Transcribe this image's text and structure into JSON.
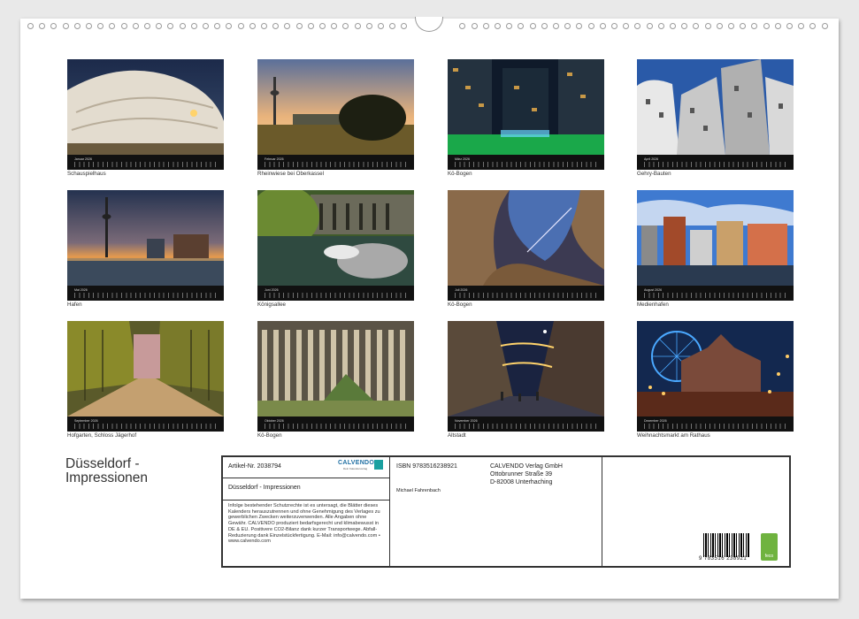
{
  "calendar": {
    "title_line1": "Düsseldorf -",
    "title_line2": "Impressionen",
    "months": [
      {
        "month": "Januar 2026",
        "caption": "Schauspielhaus"
      },
      {
        "month": "Februar 2026",
        "caption": "Rheinwiese bei Oberkassel"
      },
      {
        "month": "März 2026",
        "caption": "Kö-Bogen"
      },
      {
        "month": "April 2026",
        "caption": "Gehry-Bauten"
      },
      {
        "month": "Mai 2026",
        "caption": "Hafen"
      },
      {
        "month": "Juni 2026",
        "caption": "Königsallee"
      },
      {
        "month": "Juli 2026",
        "caption": "Kö-Bogen"
      },
      {
        "month": "August 2026",
        "caption": "Medienhafen"
      },
      {
        "month": "September 2026",
        "caption": "Hofgarten, Schloss Jägerhof"
      },
      {
        "month": "Oktober 2026",
        "caption": "Kö-Bogen"
      },
      {
        "month": "November 2026",
        "caption": "Altstadt"
      },
      {
        "month": "Dezember 2026",
        "caption": "Weihnachtsmarkt am Rathaus"
      }
    ]
  },
  "info": {
    "article": "Artikel-Nr. 2038794",
    "logo": "CALVENDO",
    "logo_sub": "Dein Kalenderverlag",
    "product_title": "Düsseldorf - Impressionen",
    "legal": "Infolge bestehender Schutzrechte ist es untersagt, die Blätter dieses Kalenders herauszutrennen und ohne Genehmigung des Verlages zu gewerblichen Zwecken weiterzuverwenden. Alle Angaben ohne Gewähr. CALVENDO produziert bedarfsgerecht und klimabewusst in DE & EU. Positivere CO2-Bilanz dank kurzer Transportwege. Abfall-Reduzierung dank Einzelstückfertigung. E-Mail: info@calvendo.com • www.calvendo.com",
    "isbn": "ISBN 9783516238921",
    "author": "Michael Fahrenbach",
    "publisher_name": "CALVENDO Verlag GmbH",
    "publisher_street": "Ottobrunner Straße 39",
    "publisher_city": "D-82008 Unterhaching",
    "barcode_number": "9 783516 238921",
    "feco_label": "feco"
  },
  "colors": {
    "sheet": "#ffffff",
    "calendar_bar": "#111111",
    "feco_green": "#6fb33f",
    "calvendo_blue": "#1f6fa3"
  }
}
